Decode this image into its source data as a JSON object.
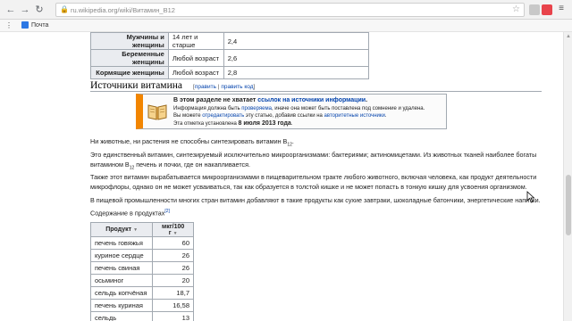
{
  "browser": {
    "url": "ru.wikipedia.org/wiki/Витамин_B12",
    "bookmark_label": "Почта"
  },
  "table1": {
    "rows": [
      {
        "group": "Мужчины и женщины",
        "age": "14 лет и старше",
        "value": "2,4"
      },
      {
        "group": "Беременные женщины",
        "age": "Любой возраст",
        "value": "2,6"
      },
      {
        "group": "Кормящие женщины",
        "age": "Любой возраст",
        "value": "2,8"
      }
    ]
  },
  "section": {
    "title": "Источники витамина",
    "edit_open": "[",
    "edit": "править",
    "edit_sep": " | ",
    "edit_code": "править код",
    "edit_close": "]"
  },
  "ambox": {
    "title_prefix": "В этом разделе не хватает ",
    "title_link": "ссылок на источники информации",
    "title_suffix": ".",
    "line1_prefix": "Информация должна быть ",
    "line1_link": "проверяема",
    "line1_suffix": ", иначе она может быть поставлена под сомнение и удалена.",
    "line2_prefix": "Вы можете ",
    "line2_link1": "отредактировать",
    "line2_mid": " эту статью, добавив ссылки на ",
    "line2_link2": "авторитетные источники",
    "line2_suffix": ".",
    "line3_prefix": "Эта отметка установлена ",
    "line3_date": "8 июля 2013 года",
    "line3_suffix": "."
  },
  "paragraphs": {
    "p1_text": "Ни животные, ни растения не способны синтезировать витамин B",
    "p1_sub": "12",
    "p1_end": ".",
    "p2_a": "Это единственный витамин, синтезируемый исключительно микроорганизмами: бактериями; актиномицетами. Из животных тканей наиболее богаты",
    "p2_b": "витамином B",
    "p2_sub": "12",
    "p2_c": " печень и почки, где он накапливается.",
    "p3_a": "Также этот витамин вырабатывается микроорганизмами в пищеварительном тракте любого животного, включая человека, как продукт деятельности",
    "p3_b": "микрофлоры, однако он не может усваиваться, так как образуется в толстой кишке и не может попасть в тонкую кишку для усвоения организмом.",
    "p4": "В пищевой промышленности многих стран витамин добавляют в такие продукты как сухие завтраки, шоколадные батончики, энергетические напитки.",
    "p5": "Содержание в продуктах",
    "p5_ref": "[2]"
  },
  "table2": {
    "headers": [
      "Продукт",
      "мкг/100 г"
    ],
    "rows": [
      {
        "product": "печень говяжья",
        "value": "60"
      },
      {
        "product": "куриное сердце",
        "value": "26"
      },
      {
        "product": "печень свиная",
        "value": "26"
      },
      {
        "product": "осьминог",
        "value": "20"
      },
      {
        "product": "сельдь копчёная",
        "value": "18,7"
      },
      {
        "product": "печень куриная",
        "value": "16,58"
      },
      {
        "product": "сельдь",
        "value": "13"
      }
    ]
  },
  "colors": {
    "link": "#0645ad",
    "ambox_stripe": "#f28500",
    "table_header": "#eaecf0"
  }
}
